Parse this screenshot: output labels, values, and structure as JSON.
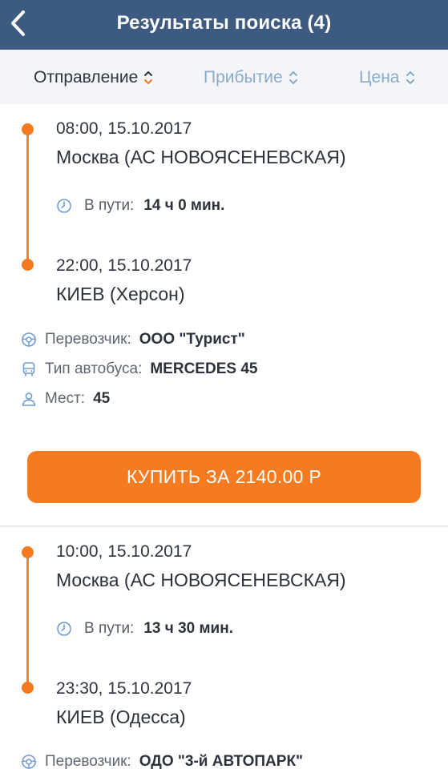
{
  "header": {
    "title": "Результаты поиска (4)"
  },
  "sort": {
    "departure": "Отправление",
    "arrival": "Прибытие",
    "price": "Цена"
  },
  "results": [
    {
      "dep_time": "08:00,  15.10.2017",
      "dep_city": "Москва (АС НОВОЯСЕНЕВСКАЯ)",
      "duration_label": "В пути:",
      "duration": "14 ч 0 мин.",
      "arr_time": "22:00,  15.10.2017",
      "arr_city": "КИЕВ (Херсон)",
      "carrier_label": "Перевозчик:",
      "carrier": "ООО \"Турист\"",
      "bus_label": "Тип автобуса:",
      "bus": "MERCEDES 45",
      "seats_label": "Мест:",
      "seats": "45",
      "buy_label": "КУПИТЬ ЗА 2140.00 Р"
    },
    {
      "dep_time": "10:00,  15.10.2017",
      "dep_city": "Москва (АС НОВОЯСЕНЕВСКАЯ)",
      "duration_label": "В пути:",
      "duration": "13 ч 30 мин.",
      "arr_time": "23:30,  15.10.2017",
      "arr_city": "КИЕВ (Одесса)",
      "carrier_label": "Перевозчик:",
      "carrier": "ОДО \"3-й АВТОПАРК\""
    }
  ],
  "colors": {
    "header": "#3d5a80",
    "accent": "#f47b20",
    "sort_active": "#2d3540",
    "sort_inactive": "#8aaac7",
    "sortbar_bg": "#f3f5f8"
  }
}
